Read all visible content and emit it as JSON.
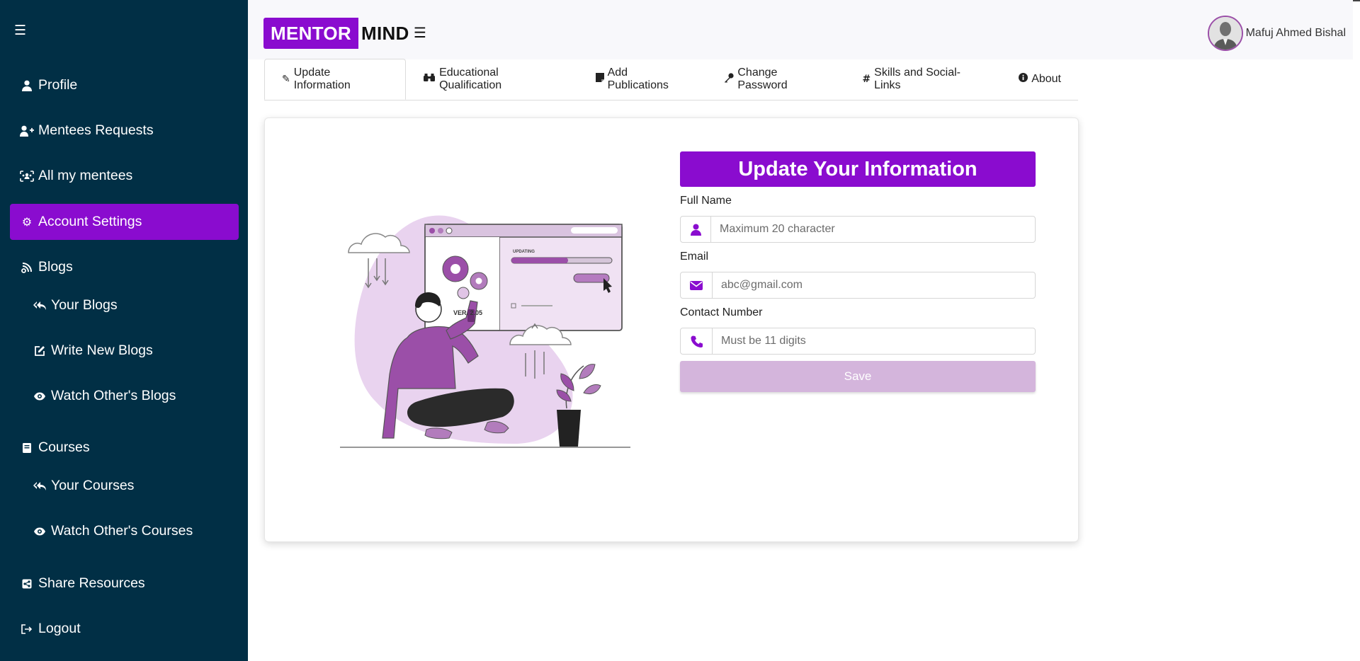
{
  "sidebar": {
    "items": [
      {
        "label": "Profile",
        "icon": "user-icon"
      },
      {
        "label": "Mentees Requests",
        "icon": "user-plus-icon"
      },
      {
        "label": "All my mentees",
        "icon": "users-rect-icon"
      },
      {
        "label": "Account Settings",
        "icon": "gear-icon",
        "active": true
      },
      {
        "label": "Blogs",
        "icon": "blog-icon"
      },
      {
        "label": "Your Blogs",
        "icon": "reply-all-icon"
      },
      {
        "label": "Write New Blogs",
        "icon": "edit-icon"
      },
      {
        "label": "Watch Other's Blogs",
        "icon": "eye-icon"
      },
      {
        "label": "Courses",
        "icon": "book-icon"
      },
      {
        "label": "Your Courses",
        "icon": "reply-all-icon"
      },
      {
        "label": "Watch Other's Courses",
        "icon": "eye-icon"
      },
      {
        "label": "Share Resources",
        "icon": "share-icon"
      },
      {
        "label": "Logout",
        "icon": "logout-icon"
      }
    ]
  },
  "header": {
    "logo_part1": "MENTOR",
    "logo_part2": "MIND",
    "user_name": "Mafuj Ahmed Bishal"
  },
  "tabs": [
    {
      "label": "Update Information",
      "icon": "pencil-icon",
      "active": true
    },
    {
      "label": "Educational Qualification",
      "icon": "binoculars-icon"
    },
    {
      "label": "Add Publications",
      "icon": "sticky-note-icon"
    },
    {
      "label": "Change Password",
      "icon": "key-icon"
    },
    {
      "label": "Skills and Social-Links",
      "icon": "hashtag-icon"
    },
    {
      "label": "About",
      "icon": "info-icon"
    }
  ],
  "form": {
    "title": "Update Your Information",
    "full_name_label": "Full Name",
    "full_name_placeholder": "Maximum 20 character",
    "email_label": "Email",
    "email_placeholder": "abc@gmail.com",
    "contact_label": "Contact Number",
    "contact_placeholder": "Must be 11 digits",
    "save_label": "Save"
  },
  "illustration": {
    "updating_text": "UPDATING",
    "version_text": "VER. 2.05"
  },
  "colors": {
    "accent": "#8a0ccf",
    "sidebar_bg": "#012f45",
    "save_disabled": "#d4b5dc"
  }
}
